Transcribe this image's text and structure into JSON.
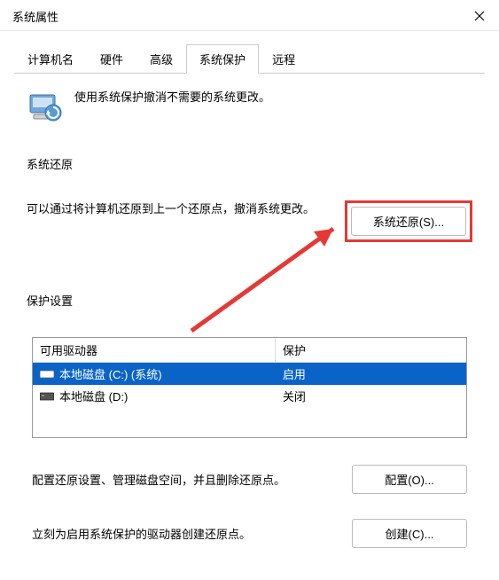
{
  "window": {
    "title": "系统属性"
  },
  "tabs": {
    "items": [
      {
        "label": "计算机名"
      },
      {
        "label": "硬件"
      },
      {
        "label": "高级"
      },
      {
        "label": "系统保护"
      },
      {
        "label": "远程"
      }
    ],
    "active_index": 3
  },
  "content": {
    "intro": "使用系统保护撤消不需要的系统更改。",
    "restore_section_label": "系统还原",
    "restore_text": "可以通过将计算机还原到上一个还原点，撤消系统更改。",
    "restore_button": "系统还原(S)...",
    "protect_section_label": "保护设置",
    "table": {
      "col_drive": "可用驱动器",
      "col_protect": "保护",
      "rows": [
        {
          "name": "本地磁盘 (C:) (系统)",
          "protect": "启用",
          "selected": true
        },
        {
          "name": "本地磁盘 (D:)",
          "protect": "关闭",
          "selected": false
        }
      ]
    },
    "configure_text": "配置还原设置、管理磁盘空间，并且删除还原点。",
    "configure_button": "配置(O)...",
    "create_text": "立刻为启用系统保护的驱动器创建还原点。",
    "create_button": "创建(C)..."
  }
}
